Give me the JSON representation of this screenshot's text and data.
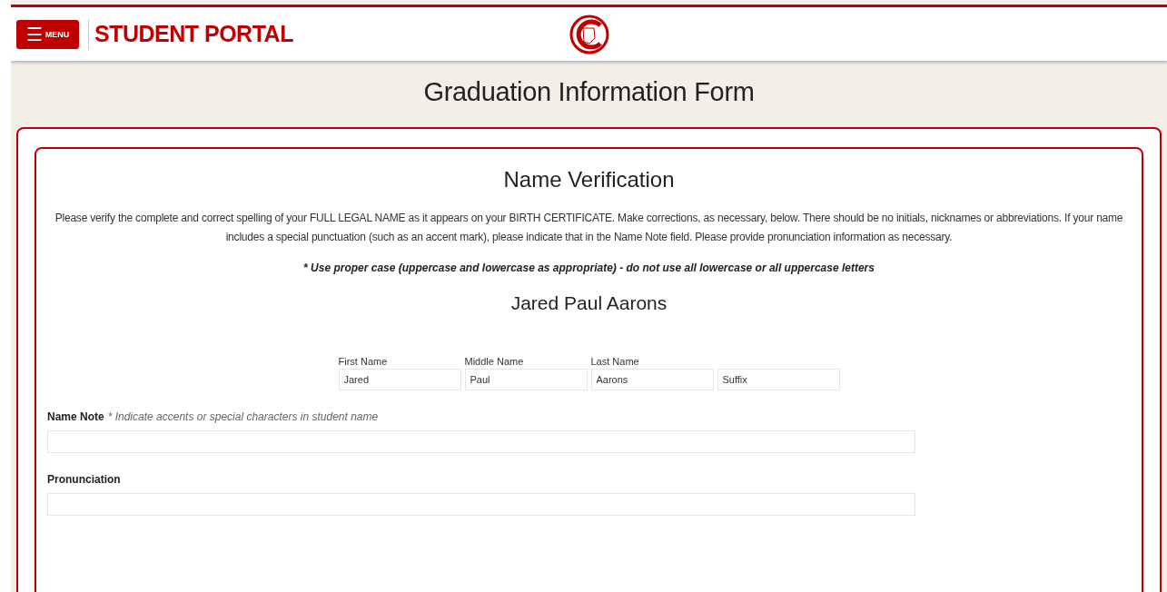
{
  "header": {
    "menu_button": {
      "icon": "☰",
      "label": "MENU"
    },
    "title": "STUDENT PORTAL"
  },
  "page_title": "Graduation Information Form",
  "section": {
    "title": "Name Verification",
    "instructions": "Please verify the complete and correct spelling of your FULL LEGAL NAME as it appears on your BIRTH CERTIFICATE. Make corrections, as necessary, below. There should be no initials, nicknames or abbreviations. If your name includes a special punctuation (such as an accent mark), please indicate that in the Name Note field. Please provide pronunciation information as necessary.",
    "case_note": "* Use proper case (uppercase and lowercase as appropriate) - do not use all lowercase or all uppercase letters",
    "full_name": "Jared Paul Aarons",
    "name_fields": [
      {
        "label": "First Name",
        "value": "Jared"
      },
      {
        "label": "Middle Name",
        "value": "Paul"
      },
      {
        "label": "Last Name",
        "value": "Aarons"
      },
      {
        "placeholder": "Suffix"
      }
    ],
    "fields": [
      {
        "label": "Name Note",
        "hint": "* Indicate accents or special characters in student name"
      },
      {
        "label": "Pronunciation"
      }
    ]
  }
}
